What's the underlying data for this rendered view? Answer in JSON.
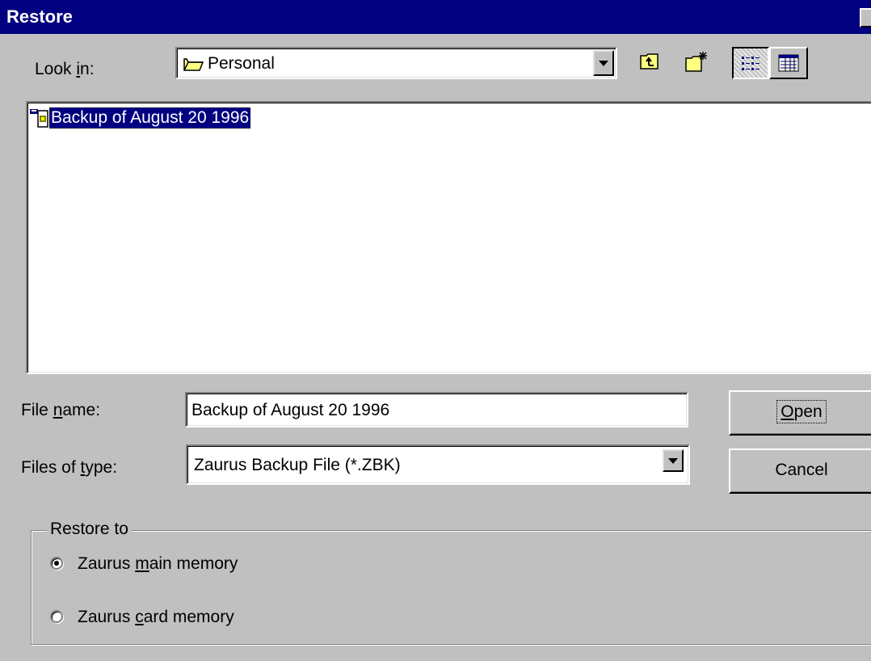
{
  "window": {
    "title": "Restore"
  },
  "look_in": {
    "label_pre": "Look ",
    "label_accel": "i",
    "label_post": "n:",
    "value": "Personal"
  },
  "toolbar": {
    "up_folder": "up-one-level-icon",
    "new_folder": "create-new-folder-icon",
    "list_view": "list-view-icon",
    "details_view": "details-view-icon"
  },
  "file_list": {
    "items": [
      {
        "label": "Backup of August 20 1996",
        "icon": "zaurus-backup-file-icon",
        "selected": true
      }
    ]
  },
  "file_name": {
    "label_pre": "File ",
    "label_accel": "n",
    "label_post": "ame:",
    "value": "Backup of August 20 1996"
  },
  "file_type": {
    "label_pre": "Files of ",
    "label_accel": "t",
    "label_post": "ype:",
    "value": "Zaurus Backup File (*.ZBK)"
  },
  "buttons": {
    "open": {
      "accel": "O",
      "rest": "pen"
    },
    "cancel": "Cancel"
  },
  "restore_to": {
    "legend": "Restore to",
    "options": [
      {
        "pre": "Zaurus ",
        "accel": "m",
        "post": "ain memory",
        "selected": true
      },
      {
        "pre": "Zaurus ",
        "accel": "c",
        "post": "ard memory",
        "selected": false
      }
    ]
  }
}
